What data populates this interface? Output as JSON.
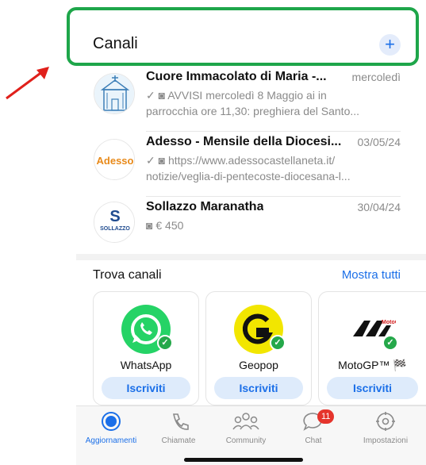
{
  "header": {
    "title": "Canali",
    "add_icon": "plus-icon"
  },
  "channels": [
    {
      "name": "Cuore Immacolato di Maria -...",
      "date": "mercoledì",
      "line1": "AVVISI mercoledì 8 Maggio ai in",
      "line2": "parrocchia ore 11,30: preghiera del Santo...",
      "icons": [
        "check-icon",
        "camera-icon"
      ]
    },
    {
      "name": "Adesso - Mensile della Diocesi...",
      "date": "03/05/24",
      "line1": "https://www.adessocastellaneta.it/",
      "line2": "notizie/veglia-di-pentecoste-diocesana-l...",
      "icons": [
        "check-icon",
        "camera-icon"
      ],
      "avatar_text": "Adesso"
    },
    {
      "name": "Sollazzo Maranatha",
      "date": "30/04/24",
      "line1": "€ 450",
      "icons": [
        "camera-icon"
      ],
      "avatar_text": "SOLLAZZO"
    }
  ],
  "find": {
    "title": "Trova canali",
    "show_all": "Mostra tutti",
    "cards": [
      {
        "name": "WhatsApp",
        "button": "Iscriviti",
        "color": "#25D366"
      },
      {
        "name": "Geopop",
        "button": "Iscriviti",
        "color": "#F2E600"
      },
      {
        "name": "MotoGP™ 🏁",
        "button": "Iscriviti",
        "color": "#111111"
      }
    ]
  },
  "tabbar": {
    "tabs": [
      {
        "label": "Aggiornamenti",
        "icon": "updates-icon",
        "active": true
      },
      {
        "label": "Chiamate",
        "icon": "phone-icon"
      },
      {
        "label": "Community",
        "icon": "community-icon"
      },
      {
        "label": "Chat",
        "icon": "chat-icon",
        "badge": "11"
      },
      {
        "label": "Impostazioni",
        "icon": "gear-icon"
      }
    ]
  },
  "colors": {
    "accent": "#1b6fe8",
    "highlight": "#1ea64a",
    "arrow": "#e0201b",
    "badge": "#e5342c"
  }
}
